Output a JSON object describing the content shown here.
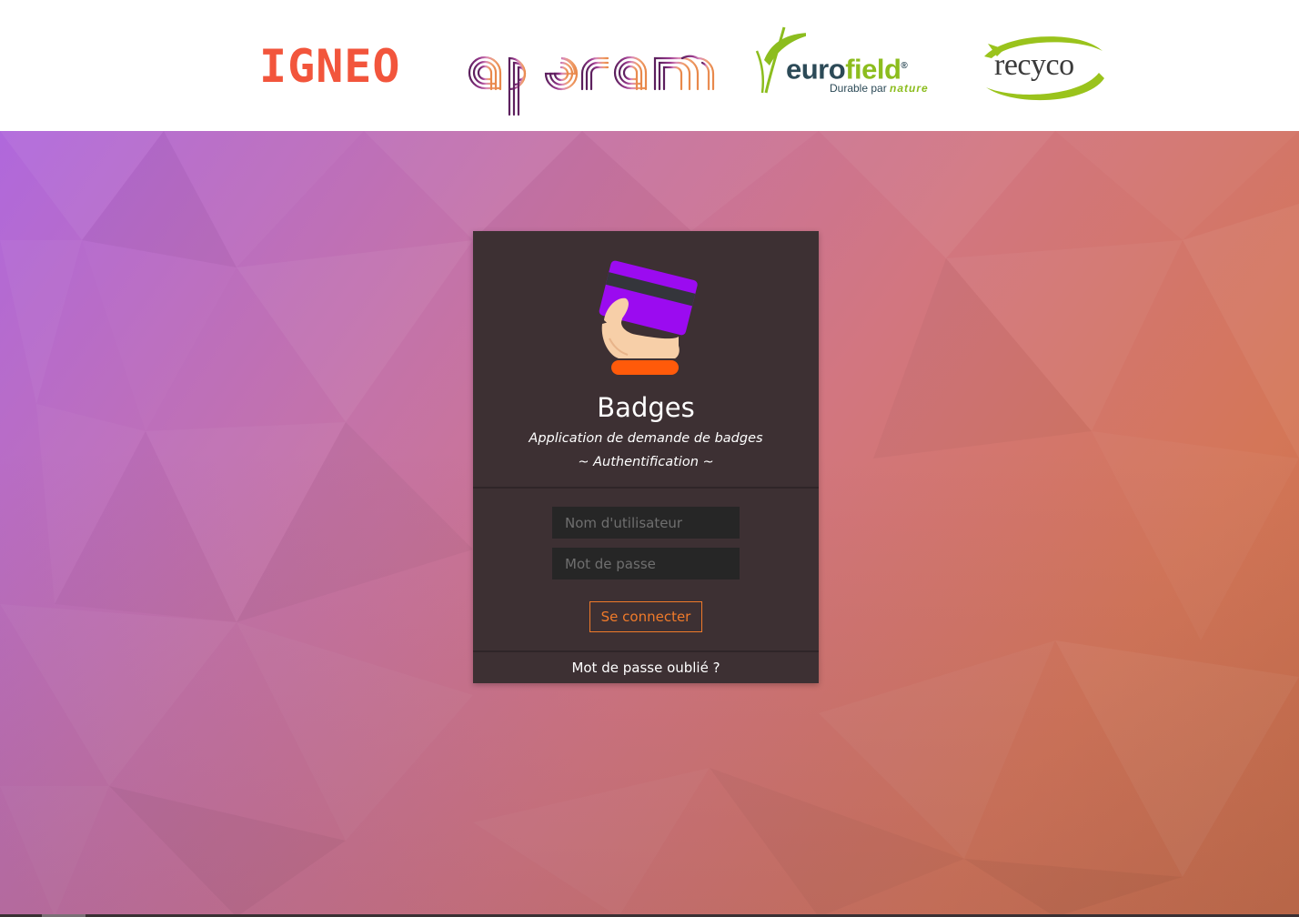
{
  "header": {
    "logos": {
      "igneo": {
        "text": "IGNEO",
        "color": "#f2553c"
      },
      "aperam": {
        "text": "aperam"
      },
      "eurofield": {
        "text_euro": "euro",
        "text_field": "field",
        "registered": "®",
        "tagline_prefix": "Durable par",
        "tagline_nature": "nature"
      },
      "recyco": {
        "text": "recyco"
      }
    }
  },
  "login": {
    "icon": "hand-holding-card-icon",
    "title": "Badges",
    "subtitle": "Application de demande de badges",
    "section": "~ Authentification ~",
    "username_placeholder": "Nom d'utilisateur",
    "password_placeholder": "Mot de passe",
    "submit_label": "Se connecter",
    "forgot_label": "Mot de passe oublié ?"
  },
  "colors": {
    "accent": "#f07a2a",
    "card_background": "#3d3033",
    "input_background": "#262626"
  }
}
